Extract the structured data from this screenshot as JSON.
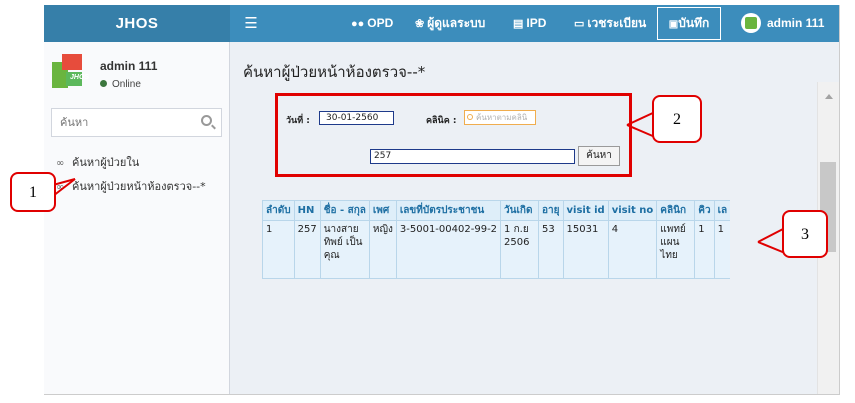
{
  "app": {
    "brand": "JHOS",
    "menu_icon": "hamburger-icon",
    "nav": [
      {
        "label": "OPD",
        "icon": "users-icon"
      },
      {
        "label": "ผู้ดูแลระบบ",
        "icon": "cogs-icon"
      },
      {
        "label": "IPD",
        "icon": "bed-icon"
      },
      {
        "label": "เวชระเบียน",
        "icon": "card-icon"
      }
    ],
    "save_label": "บันทึก",
    "user_name": "admin 111"
  },
  "sidebar": {
    "user_name": "admin 111",
    "status": "Online",
    "search_placeholder": "ค้นหา",
    "items": [
      {
        "label": "ค้นหาผู้ป่วยใน"
      },
      {
        "label": "ค้นหาผู้ป่วยหน้าห้องตรวจ--*"
      }
    ]
  },
  "main": {
    "title": "ค้นหาผู้ป่วยหน้าห้องตรวจ--*",
    "form": {
      "date_label": "วันที่ :",
      "date_value": "30-01-2560",
      "clinic_label": "คลินิค :",
      "clinic_placeholder": "ค้นหาตามคลินิ",
      "hn_value": "257",
      "search_button": "ค้นหา"
    },
    "table": {
      "headers": [
        "ลำดับ",
        "HN",
        "ชื่อ - สกุล",
        "เพศ",
        "เลขที่บัตรประชาชน",
        "วันเกิด",
        "อายุ",
        "visit id",
        "visit no",
        "คลินิก",
        "คิว",
        "เล"
      ],
      "rows": [
        [
          "1",
          "257",
          "นางสาย ทิพย์ เป็น คุณ",
          "หญิง",
          "3-5001-00402-99-2",
          "1 ก.ย 2506",
          "53",
          "15031",
          "4",
          "แพทย์ แผน ไทย",
          "1",
          "1"
        ]
      ]
    }
  },
  "annotations": {
    "callout_1": "1",
    "callout_2": "2",
    "callout_3": "3",
    "color": "#e00000"
  }
}
